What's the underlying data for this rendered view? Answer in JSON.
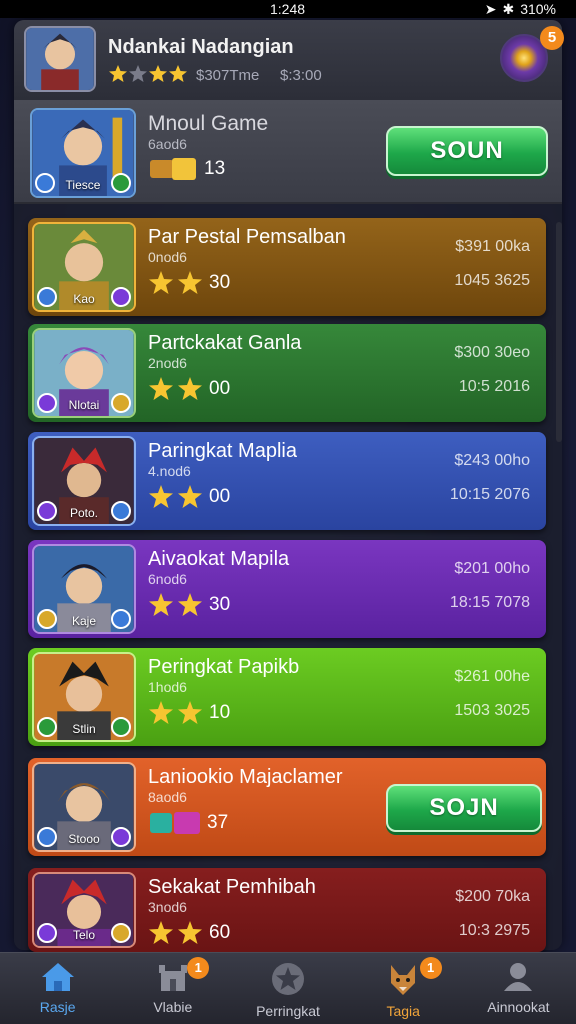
{
  "status_bar": {
    "time": "1:248",
    "battery": "310%"
  },
  "header": {
    "title": "Ndankai Nadangian",
    "stat_1": "$307Tme",
    "stat_2": "$:3:00",
    "orb_badge": "5"
  },
  "featured": {
    "title": "Mnoul Game",
    "subtitle": "6aod6",
    "count": "13",
    "avatar_label": "Tiesce",
    "join_label": "SOUN"
  },
  "cards": [
    {
      "title": "Par Pestal Pemsalban",
      "subtitle": "0nod6",
      "rating": "30",
      "price": "$391 00ka",
      "stat": "1045 3625",
      "avatar_label": "Kao"
    },
    {
      "title": "Partckakat Ganla",
      "subtitle": "2nod6",
      "rating": "00",
      "price": "$300 30eo",
      "stat": "10:5 2016",
      "avatar_label": "Nlotai"
    },
    {
      "title": "Paringkat Maplia",
      "subtitle": "4.nod6",
      "rating": "00",
      "price": "$243 00ho",
      "stat": "10:15 2076",
      "avatar_label": "Poto."
    },
    {
      "title": "Aivaokat Mapila",
      "subtitle": "6nod6",
      "rating": "30",
      "price": "$201 00ho",
      "stat": "18:15 7078",
      "avatar_label": "Kaje"
    },
    {
      "title": "Peringkat Papikb",
      "subtitle": "1hod6",
      "rating": "10",
      "price": "$261 00he",
      "stat": "1503 3025",
      "avatar_label": "Stlin"
    },
    {
      "title": "Laniookio Majaclamer",
      "subtitle": "8aod6",
      "rating": "37",
      "join_label": "SOJN",
      "avatar_label": "Stooo"
    },
    {
      "title": "Sekakat Pemhibah",
      "subtitle": "3nod6",
      "rating": "60",
      "price": "$200 70ka",
      "stat": "10:3 2975",
      "avatar_label": "Telo"
    }
  ],
  "nav": [
    {
      "label": "Rasje"
    },
    {
      "label": "Vlabie",
      "badge": "1"
    },
    {
      "label": "Perringkat"
    },
    {
      "label": "Tagia",
      "badge": "1"
    },
    {
      "label": "Ainnookat"
    }
  ],
  "colors": {
    "card_1": "#8a5a10",
    "card_2": "#2e7a32",
    "card_3": "#3652b0",
    "card_4": "#6a2eb0",
    "card_5": "#5cb81e",
    "card_6": "#d2561c",
    "card_7": "#7a1a1a",
    "join_green": "#1ea84a",
    "badge_orange": "#f38a1c"
  }
}
